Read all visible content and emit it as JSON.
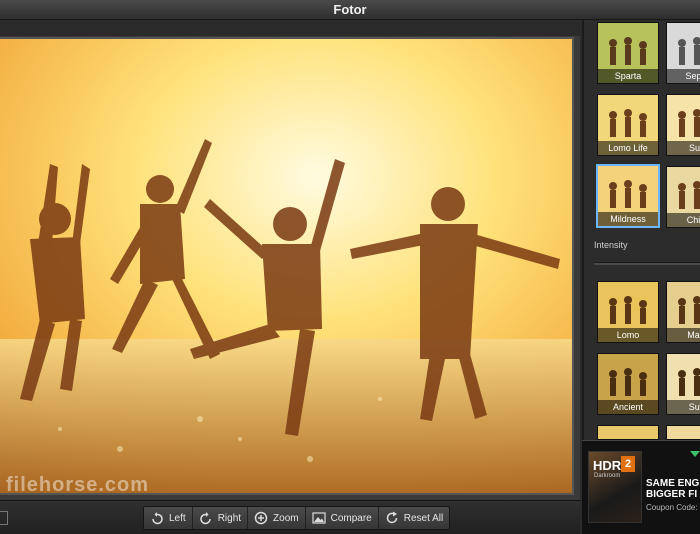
{
  "window": {
    "title": "Fotor"
  },
  "watermark": "filehorse.com",
  "toolbar": {
    "buttons": [
      {
        "label": "Left",
        "icon": "rotate-left-icon"
      },
      {
        "label": "Right",
        "icon": "rotate-right-icon"
      },
      {
        "label": "Zoom",
        "icon": "zoom-icon"
      },
      {
        "label": "Compare",
        "icon": "compare-icon"
      },
      {
        "label": "Reset All",
        "icon": "reset-icon"
      }
    ]
  },
  "effects_panel": {
    "group1": [
      {
        "label": "Sparta"
      },
      {
        "label": "Sepia"
      },
      {
        "label": "Lomo Life"
      },
      {
        "label": "Sun"
      },
      {
        "label": "Mildness",
        "selected": true
      },
      {
        "label": "Child"
      }
    ],
    "intensity_label": "Intensity",
    "group2": [
      {
        "label": "Lomo"
      },
      {
        "label": "Mald"
      },
      {
        "label": "Ancient"
      },
      {
        "label": "Sutr"
      }
    ]
  },
  "ad": {
    "product": "HDR",
    "version": "2",
    "sub": "Darkroom",
    "line1": "SAME ENGI",
    "line2": "BIGGER FI",
    "line3": "Coupon Code: F"
  },
  "colors": {
    "accent": "#6ab6ff",
    "ad_orange": "#e07010"
  }
}
